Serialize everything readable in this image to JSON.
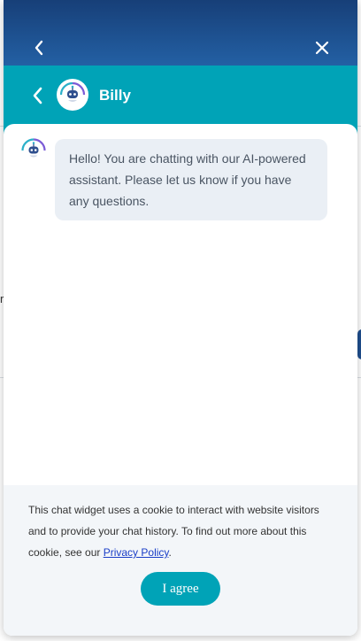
{
  "header": {
    "back_icon": "chevron-left-icon",
    "close_icon": "close-icon"
  },
  "agent": {
    "name": "Billy",
    "avatar_icon": "robot-icon"
  },
  "chat": {
    "messages": [
      {
        "sender": "Billy",
        "text": "Hello! You are chatting with our AI-powered assistant. Please let us know if you have any questions."
      }
    ]
  },
  "cookie": {
    "text_before_link": "This chat widget uses a cookie to interact with website visitors and to provide your chat history. To find out more about this cookie, see our ",
    "link_text": "Privacy Policy",
    "text_after_link": ".",
    "agree_label": "I agree"
  },
  "colors": {
    "header_top": "#173f78",
    "header_bottom": "#2360a4",
    "accent": "#00a3b7",
    "bubble": "#eaeff5",
    "cookie_bg": "#f3f6f9",
    "link": "#1a3ec7"
  }
}
